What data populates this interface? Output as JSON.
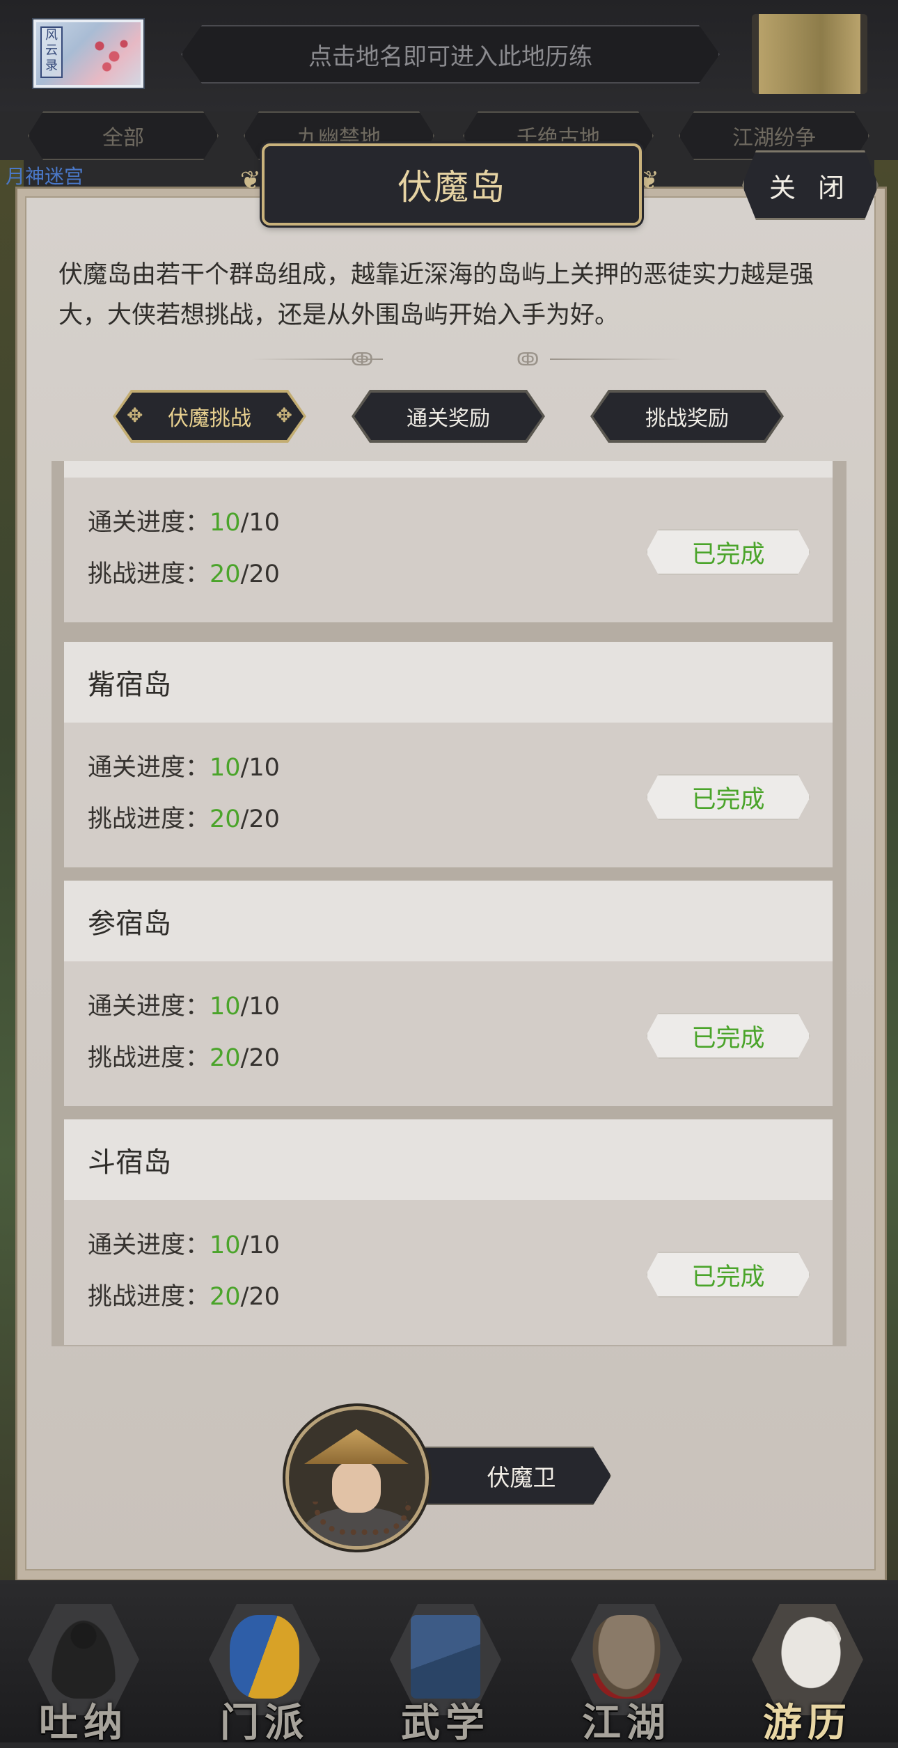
{
  "top": {
    "hint": "点击地名即可进入此地历练",
    "thumb_seal": "风云录",
    "categories": [
      "全部",
      "九幽禁地",
      "千绝古地",
      "江湖纷争"
    ],
    "map_label": "月神迷宫"
  },
  "panel": {
    "title": "伏魔岛",
    "close_label": "关 闭",
    "description": "伏魔岛由若干个群岛组成，越靠近深海的岛屿上关押的恶徒实力越是强大，大侠若想挑战，还是从外围岛屿开始入手为好。",
    "tabs": [
      {
        "label": "伏魔挑战",
        "active": true
      },
      {
        "label": "通关奖励",
        "active": false
      },
      {
        "label": "挑战奖励",
        "active": false
      }
    ]
  },
  "islands": [
    {
      "name": "",
      "clear_label": "通关进度：",
      "clear_cur": "10",
      "clear_total": "/10",
      "challenge_label": "挑战进度：",
      "challenge_cur": "20",
      "challenge_total": "/20",
      "status": "已完成"
    },
    {
      "name": "觜宿岛",
      "clear_label": "通关进度：",
      "clear_cur": "10",
      "clear_total": "/10",
      "challenge_label": "挑战进度：",
      "challenge_cur": "20",
      "challenge_total": "/20",
      "status": "已完成"
    },
    {
      "name": "参宿岛",
      "clear_label": "通关进度：",
      "clear_cur": "10",
      "clear_total": "/10",
      "challenge_label": "挑战进度：",
      "challenge_cur": "20",
      "challenge_total": "/20",
      "status": "已完成"
    },
    {
      "name": "斗宿岛",
      "clear_label": "通关进度：",
      "clear_cur": "10",
      "clear_total": "/10",
      "challenge_label": "挑战进度：",
      "challenge_cur": "20",
      "challenge_total": "/20",
      "status": "已完成"
    }
  ],
  "npc": {
    "name": "伏魔卫"
  },
  "bottom_nav": [
    {
      "label": "吐纳",
      "icon": "meditation-icon",
      "active": false
    },
    {
      "label": "门派",
      "icon": "sect-banner-icon",
      "active": false
    },
    {
      "label": "武学",
      "icon": "scroll-books-icon",
      "active": false
    },
    {
      "label": "江湖",
      "icon": "straw-hat-icon",
      "active": false
    },
    {
      "label": "游历",
      "icon": "white-horse-icon",
      "active": true
    }
  ],
  "colors": {
    "progress_green": "#4aa42a",
    "title_gold": "#e6d3a3",
    "panel_bg": "#d6d1cc"
  }
}
